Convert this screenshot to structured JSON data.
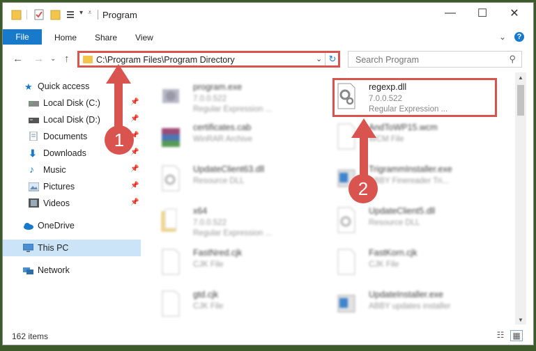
{
  "window": {
    "title": "Program",
    "controls": {
      "minimize": "—",
      "maximize": "☐",
      "close": "✕"
    }
  },
  "ribbon": {
    "tabs": [
      "File",
      "Home",
      "Share",
      "View"
    ],
    "expand_glyph": "⌄",
    "help_glyph": "?"
  },
  "nav": {
    "back_glyph": "←",
    "forward_glyph": "→",
    "recent_glyph": "⌄",
    "up_glyph": "↑",
    "address": "C:\\Program Files\\Program Directory",
    "address_chevron": "⌄",
    "refresh_glyph": "↻",
    "search_placeholder": "Search Program",
    "search_glyph": "⚲"
  },
  "sidebar": {
    "items": [
      {
        "label": "Quick access",
        "icon": "star-icon",
        "pinned": false
      },
      {
        "label": "Local Disk (C:)",
        "icon": "drive-icon",
        "pinned": true
      },
      {
        "label": "Local Disk (D:)",
        "icon": "drive-icon",
        "pinned": true
      },
      {
        "label": "Documents",
        "icon": "documents-icon",
        "pinned": true
      },
      {
        "label": "Downloads",
        "icon": "download-icon",
        "pinned": true
      },
      {
        "label": "Music",
        "icon": "music-icon",
        "pinned": true
      },
      {
        "label": "Pictures",
        "icon": "pictures-icon",
        "pinned": true
      },
      {
        "label": "Videos",
        "icon": "video-icon",
        "pinned": true
      },
      {
        "label": "OneDrive",
        "icon": "cloud-icon",
        "pinned": false
      },
      {
        "label": "This PC",
        "icon": "computer-icon",
        "pinned": false
      },
      {
        "label": "Network",
        "icon": "network-icon",
        "pinned": false
      }
    ],
    "pin_glyph": "📌"
  },
  "files": [
    {
      "name": "program.exe",
      "line2": "7.0.0.522",
      "line3": "Regular Expression ...",
      "icon": "exe-icon"
    },
    {
      "name": "regexp.dll",
      "line2": "7.0.0.522",
      "line3": "Regular Expression ...",
      "icon": "dll-gear-icon"
    },
    {
      "name": "certificates.cab",
      "line2": "WinRAR Archive",
      "line3": "",
      "icon": "archive-icon"
    },
    {
      "name": "AndToWP15.wcm",
      "line2": "WCM File",
      "line3": "",
      "icon": "file-icon"
    },
    {
      "name": "UpdateClient63.dll",
      "line2": "Resource DLL",
      "line3": "",
      "icon": "dll-gear-icon"
    },
    {
      "name": "TrigrammInstaller.exe",
      "line2": "ABBY Finereader Tri...",
      "line3": "",
      "icon": "installer-icon"
    },
    {
      "name": "x64",
      "line2": "7.0.0.522",
      "line3": "Regular Expression ...",
      "icon": "folder-icon"
    },
    {
      "name": "UpdateClient5.dll",
      "line2": "Resource DLL",
      "line3": "",
      "icon": "dll-gear-icon"
    },
    {
      "name": "FastNred.cjk",
      "line2": "CJK File",
      "line3": "",
      "icon": "file-icon"
    },
    {
      "name": "FastKorn.cjk",
      "line2": "CJK File",
      "line3": "",
      "icon": "file-icon"
    },
    {
      "name": "gtd.cjk",
      "line2": "CJK File",
      "line3": "",
      "icon": "file-icon"
    },
    {
      "name": "UpdateInstaller.exe",
      "line2": "ABBY updates installer",
      "line3": "",
      "icon": "installer-icon"
    }
  ],
  "status": {
    "items_count": "162 items"
  },
  "annotations": [
    {
      "label": "1"
    },
    {
      "label": "2"
    }
  ],
  "colors": {
    "accent": "#1979ca",
    "highlight": "#d9534f",
    "selected": "#cce4f7"
  }
}
